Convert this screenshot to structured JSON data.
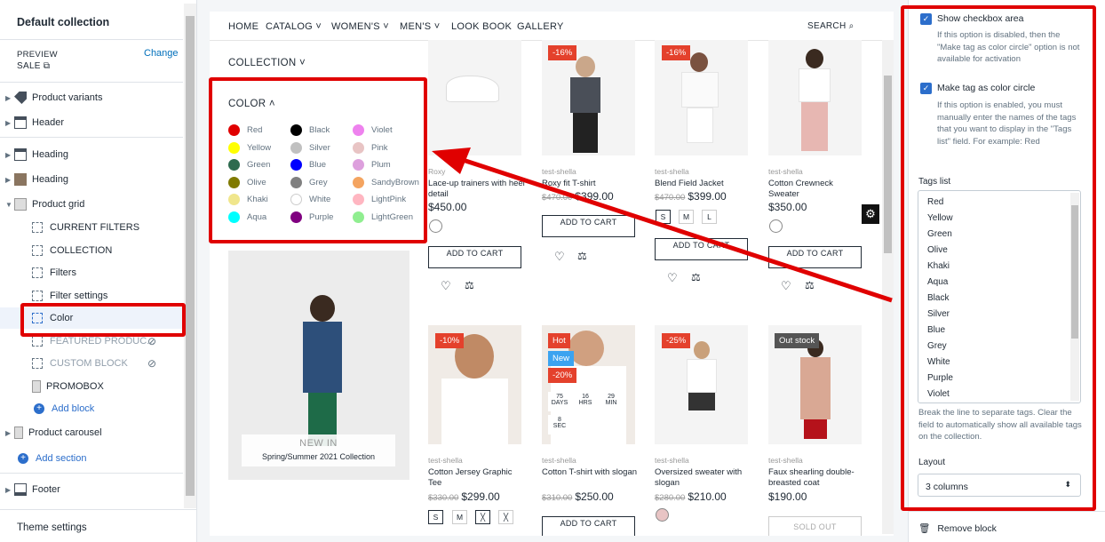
{
  "sidebar": {
    "title": "Default collection",
    "preview_label": "PREVIEW",
    "preview_value": "SALE",
    "change_label": "Change",
    "items": [
      {
        "label": "Product variants"
      },
      {
        "label": "Header"
      },
      {
        "label": "Heading"
      },
      {
        "label": "Heading"
      },
      {
        "label": "Product grid"
      }
    ],
    "sub_items": [
      {
        "label": "CURRENT FILTERS"
      },
      {
        "label": "COLLECTION"
      },
      {
        "label": "Filters"
      },
      {
        "label": "Filter settings"
      },
      {
        "label": "Color"
      },
      {
        "label": "FEATURED PRODUC..."
      },
      {
        "label": "CUSTOM BLOCK"
      },
      {
        "label": "PROMOBOX"
      }
    ],
    "add_block": "Add block",
    "product_carousel": "Product carousel",
    "add_section": "Add section",
    "footer": "Footer",
    "theme_settings": "Theme settings"
  },
  "store": {
    "nav": [
      "HOME",
      "CATALOG",
      "WOMEN'S",
      "MEN'S",
      "LOOK BOOK",
      "GALLERY"
    ],
    "search": "SEARCH",
    "collection": "COLLECTION",
    "color_title": "COLOR",
    "colors": [
      {
        "name": "Red",
        "hex": "#e00000"
      },
      {
        "name": "Yellow",
        "hex": "#ffff00"
      },
      {
        "name": "Green",
        "hex": "#2e6b4f"
      },
      {
        "name": "Olive",
        "hex": "#807a00"
      },
      {
        "name": "Khaki",
        "hex": "#f0e68c"
      },
      {
        "name": "Aqua",
        "hex": "#00ffff"
      },
      {
        "name": "Black",
        "hex": "#000000"
      },
      {
        "name": "Silver",
        "hex": "#c0c0c0"
      },
      {
        "name": "Blue",
        "hex": "#0000ff"
      },
      {
        "name": "Grey",
        "hex": "#808080"
      },
      {
        "name": "White",
        "hex": "#ffffff"
      },
      {
        "name": "Purple",
        "hex": "#800080"
      },
      {
        "name": "Violet",
        "hex": "#ee82ee"
      },
      {
        "name": "Pink",
        "hex": "#e8c4c4"
      },
      {
        "name": "Plum",
        "hex": "#dda0dd"
      },
      {
        "name": "SandyBrown",
        "hex": "#f4a460"
      },
      {
        "name": "LightPink",
        "hex": "#ffb6c1"
      },
      {
        "name": "LightGreen",
        "hex": "#90ee90"
      }
    ],
    "promo": {
      "title": "NEW IN",
      "subtitle": "Spring/Summer 2021 Collection"
    },
    "products": [
      {
        "vendor": "Roxy",
        "name": "Lace-up trainers with heel detail",
        "price": "$450.00",
        "cart": "ADD TO CART"
      },
      {
        "vendor": "test-shella",
        "name": "Roxy fit T-shirt",
        "old": "$470.00",
        "price": "$399.00",
        "badge": "-16%",
        "cart": "ADD TO CART"
      },
      {
        "vendor": "test-shella",
        "name": "Blend Field Jacket",
        "old": "$470.00",
        "price": "$399.00",
        "badge": "-16%",
        "sizes": [
          "S",
          "M",
          "L"
        ],
        "cart": "ADD TO CART"
      },
      {
        "vendor": "test-shella",
        "name": "Cotton Crewneck Sweater",
        "price": "$350.00",
        "cart": "ADD TO CART"
      },
      {
        "vendor": "test-shella",
        "name": "Cotton Jersey Graphic Tee",
        "old": "$330.00",
        "price": "$299.00",
        "badge": "-10%",
        "sizes": [
          "S",
          "M"
        ]
      },
      {
        "vendor": "test-shella",
        "name": "Cotton T-shirt with slogan",
        "old": "$310.00",
        "price": "$250.00",
        "badges": [
          "Hot",
          "New",
          "-20%"
        ],
        "countdown": [
          "75",
          "DAYS",
          "16",
          "HRS",
          "29",
          "MIN",
          "8",
          "SEC"
        ],
        "cart": "ADD TO CART"
      },
      {
        "vendor": "test-shella",
        "name": "Oversized sweater with slogan",
        "old": "$280.00",
        "price": "$210.00",
        "badge": "-25%"
      },
      {
        "vendor": "test-shella",
        "name": "Faux shearling double-breasted coat",
        "price": "$190.00",
        "badge": "Out stock",
        "cart": "SOLD OUT"
      }
    ]
  },
  "settings": {
    "show_checkbox": "Show checkbox area",
    "show_checkbox_help": "If this option is disabled, then the \"Make tag as color circle\" option is not available for activation",
    "color_circle": "Make tag as color circle",
    "color_circle_help": "If this option is enabled, you must manually enter the names of the tags that you want to display in the \"Tags list\" field. For example: Red",
    "tags_label": "Tags list",
    "tags": [
      "Red",
      "Yellow",
      "Green",
      "Olive",
      "Khaki",
      "Aqua",
      "Black",
      "Silver",
      "Blue",
      "Grey",
      "White",
      "Purple",
      "Violet"
    ],
    "tags_help": "Break the line to separate tags. Clear the field to automatically show all available tags on the collection.",
    "layout_label": "Layout",
    "layout_value": "3 columns",
    "remove": "Remove block"
  },
  "accent": "#2c6ecb",
  "highlight": "#e00000"
}
